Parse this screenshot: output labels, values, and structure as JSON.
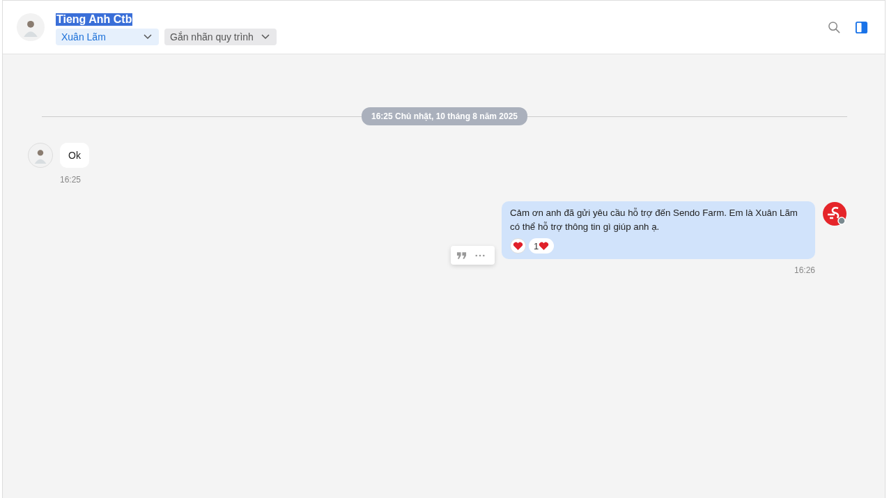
{
  "header": {
    "title": "Tieng Anh Ctb",
    "title_highlighted": true,
    "assignee": "Xuân Lãm",
    "label_dropdown": "Gắn nhãn quy trình"
  },
  "date_divider": "16:25 Chủ nhật, 10 tháng 8 năm 2025",
  "messages": [
    {
      "kind": "incoming",
      "text": "Ok",
      "time": "16:25"
    },
    {
      "kind": "outgoing",
      "text": "Cảm ơn anh đã gửi yêu cầu hỗ trợ đến Sendo Farm. Em là Xuân Lãm có thể hỗ trợ thông tin gì giúp anh ạ.",
      "time": "16:26",
      "reaction_count": "1"
    }
  ]
}
